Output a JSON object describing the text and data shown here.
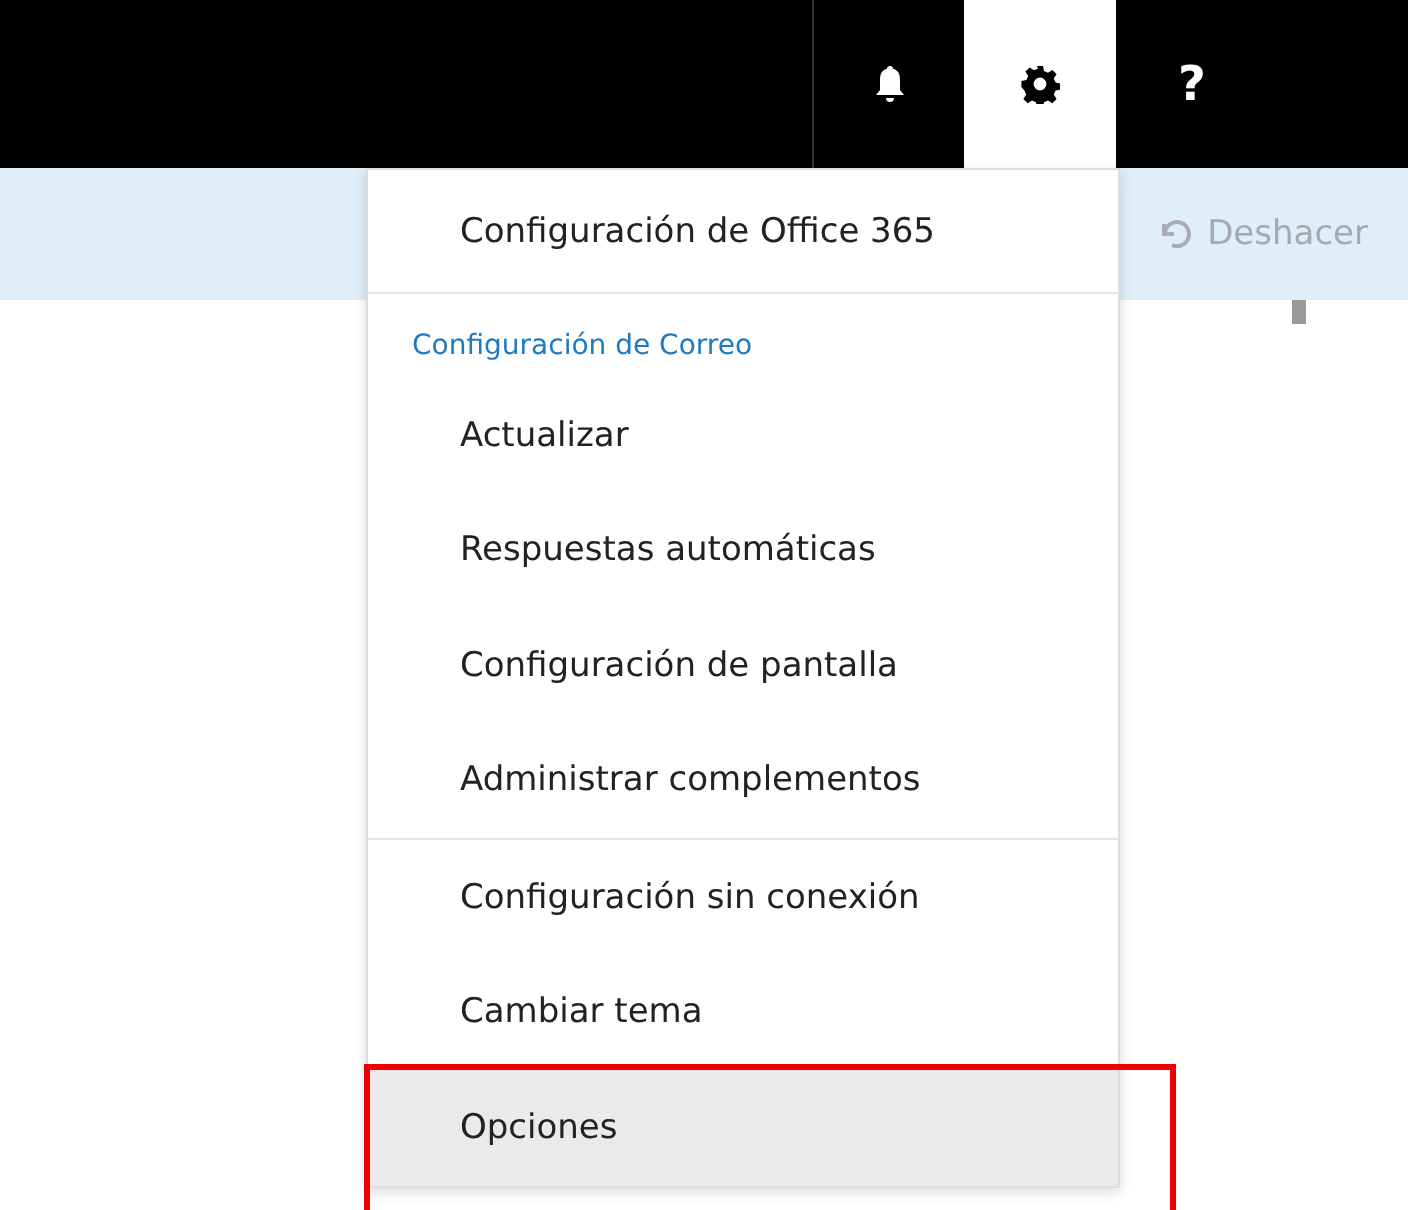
{
  "top_bar": {
    "buttons": [
      {
        "kind": "bell",
        "selected": false
      },
      {
        "kind": "gear",
        "selected": true
      },
      {
        "kind": "help",
        "label": "?",
        "selected": false
      }
    ]
  },
  "toolbar": {
    "undo": "Deshacer"
  },
  "settings_menu": {
    "items": [
      {
        "kind": "header",
        "label": "Configuración de Office 365",
        "selected": false
      },
      {
        "kind": "section",
        "label": "Configuración de Correo"
      },
      {
        "kind": "item",
        "label": "Actualizar",
        "selected": false
      },
      {
        "kind": "item",
        "label": "Respuestas automáticas",
        "selected": false
      },
      {
        "kind": "item",
        "label": "Configuración de pantalla",
        "selected": false
      },
      {
        "kind": "item",
        "label": "Administrar complementos",
        "selected": false
      },
      {
        "kind": "separator"
      },
      {
        "kind": "item",
        "label": "Configuración sin conexión",
        "selected": false
      },
      {
        "kind": "item",
        "label": "Cambiar tema",
        "selected": false
      },
      {
        "kind": "item",
        "label": "Opciones",
        "selected": true,
        "highlighted": true
      }
    ]
  }
}
